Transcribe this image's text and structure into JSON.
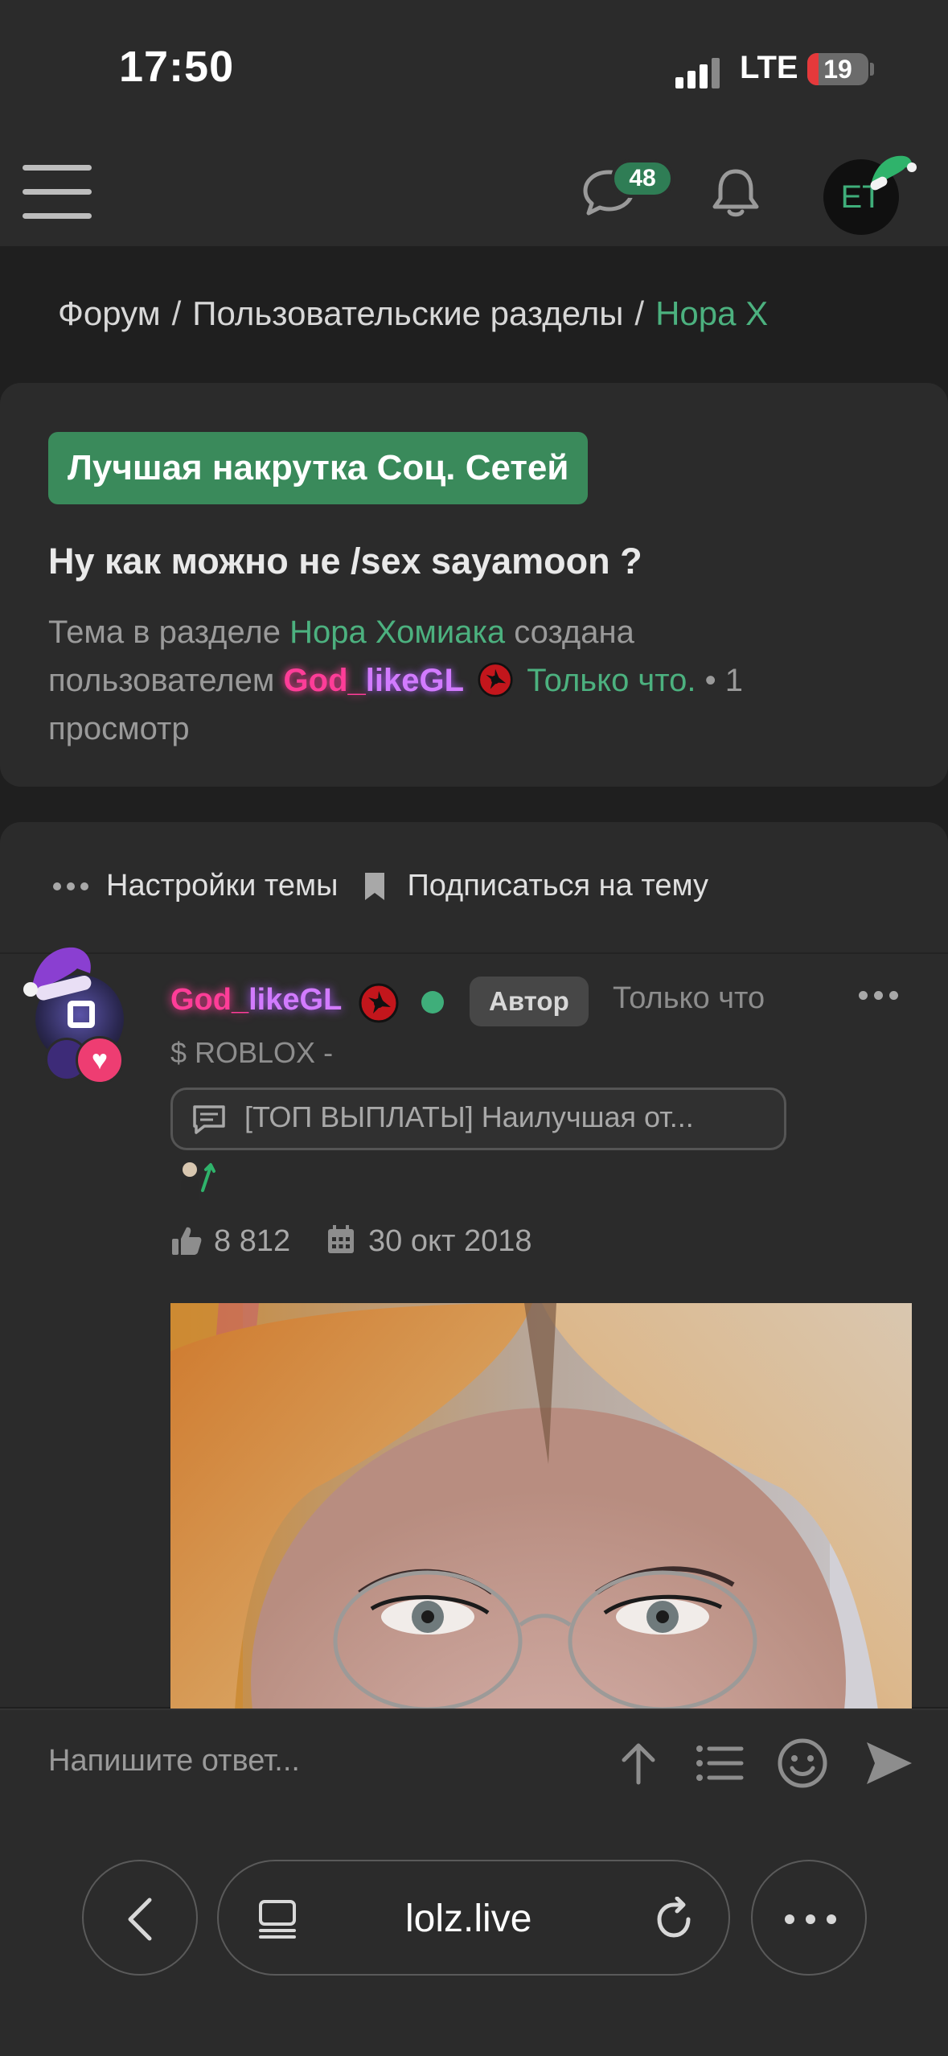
{
  "status_bar": {
    "time": "17:50",
    "network": "LTE",
    "battery": "19",
    "battery_level": 0.19
  },
  "header": {
    "messages_count": "48",
    "avatar_initials": "ET"
  },
  "breadcrumb": {
    "items": [
      "Форум",
      "Пользовательские разделы",
      "Нора Х"
    ],
    "separator": "/"
  },
  "thread": {
    "prefix": "Лучшая накрутка Соц. Сетей",
    "title": "Ну как можно не /sex sayamoon ?",
    "meta_intro": "Тема в разделе",
    "meta_section": "Нора Хомиака",
    "meta_created_by": "создана пользователем",
    "meta_author_a": "God_",
    "meta_author_b": "likeGL",
    "meta_time": "Только что.",
    "meta_views": "• 1 просмотр"
  },
  "thread_tools": {
    "settings_label": "Настройки темы",
    "subscribe_label": "Подписаться на тему"
  },
  "post": {
    "username_a": "God_",
    "username_b": "likeGL",
    "author_badge": "Автор",
    "time": "Только что",
    "user_title": "$ ROBLOX -",
    "signature": "[ТОП ВЫПЛАТЫ] Наилучшая от...",
    "likes": "8 812",
    "registered": "30 окт 2018"
  },
  "reply": {
    "placeholder": "Напишите ответ..."
  },
  "browser": {
    "url": "lolz.live"
  },
  "colors": {
    "background": "#1f1f1f",
    "panel": "#2b2b2b",
    "accent_green": "#4cb17f",
    "prefix_green": "#3a8a5b",
    "username_pink": "#ff3d98",
    "username_purple": "#d27bff"
  },
  "icons": [
    "signal-icon",
    "battery-icon",
    "hamburger-icon",
    "chat-icon",
    "bell-icon",
    "santa-hat-icon",
    "uchiha-icon",
    "dots-icon",
    "bookmark-icon",
    "heart-icon",
    "chat-bubble-icon",
    "thumbs-up-icon",
    "calendar-icon",
    "arrow-up-icon",
    "list-icon",
    "smile-icon",
    "send-icon",
    "back-icon",
    "tabs-icon",
    "reload-icon",
    "more-icon"
  ]
}
